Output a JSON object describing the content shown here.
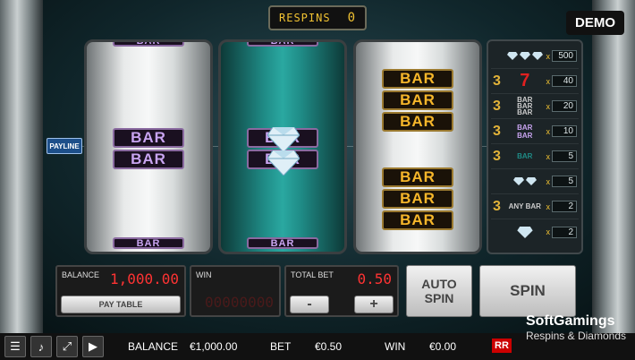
{
  "respins": {
    "label": "RESPINS",
    "value": "0"
  },
  "demo_label": "DEMO",
  "payline_label": "PAYLINE",
  "reels": {
    "symbol_bar": "BAR"
  },
  "paytable": [
    {
      "count": "",
      "symbol": "diamond-diamond-diamond",
      "mult": "500"
    },
    {
      "count": "3",
      "symbol": "seven",
      "mult": "40"
    },
    {
      "count": "3",
      "symbol": "triple-bar",
      "mult": "20"
    },
    {
      "count": "3",
      "symbol": "double-bar",
      "mult": "10"
    },
    {
      "count": "3",
      "symbol": "single-bar",
      "mult": "5"
    },
    {
      "count": "",
      "symbol": "diamond-diamond",
      "mult": "5"
    },
    {
      "count": "3",
      "symbol": "any-bar",
      "label": "ANY BAR",
      "mult": "2"
    },
    {
      "count": "",
      "symbol": "diamond",
      "mult": "2"
    }
  ],
  "paytable_x": "x",
  "controls": {
    "balance_label": "BALANCE",
    "balance_value": "1,000.00",
    "paytable_button": "PAY TABLE",
    "win_label": "WIN",
    "win_value": "00000000",
    "totalbet_label": "TOTAL BET",
    "totalbet_value": "0.50",
    "minus": "-",
    "plus": "+",
    "auto_spin": "AUTO SPIN",
    "spin": "SPIN"
  },
  "bottom_bar": {
    "balance_label": "BALANCE",
    "balance_value": "€1,000.00",
    "bet_label": "BET",
    "bet_value": "€0.50",
    "win_label": "WIN",
    "win_value": "€0.00",
    "brand": "SoftGamings",
    "game_title": "Respins & Diamonds",
    "logo_letters": "RR"
  },
  "colors": {
    "led": "#ff3333",
    "gold": "#f1c232",
    "teal": "#1f8b86"
  }
}
